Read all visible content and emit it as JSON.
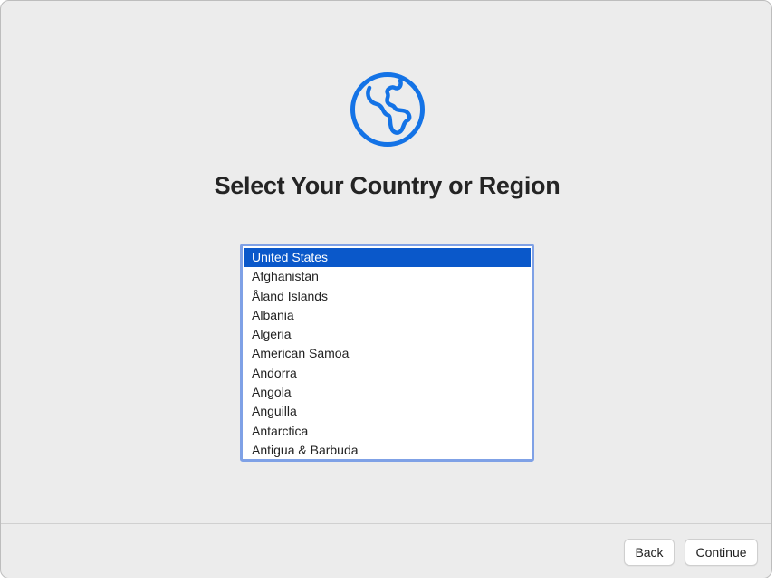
{
  "page": {
    "title": "Select Your Country or Region"
  },
  "icon": {
    "name": "globe-icon",
    "color": "#1473e6"
  },
  "country_list": {
    "selected_index": 0,
    "selection_color": "#0a58ca",
    "items": [
      "United States",
      "Afghanistan",
      "Åland Islands",
      "Albania",
      "Algeria",
      "American Samoa",
      "Andorra",
      "Angola",
      "Anguilla",
      "Antarctica",
      "Antigua & Barbuda"
    ]
  },
  "footer": {
    "back_label": "Back",
    "continue_label": "Continue"
  }
}
